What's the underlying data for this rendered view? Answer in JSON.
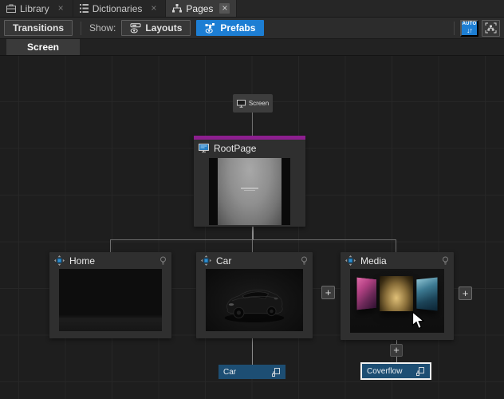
{
  "tab_bar": {
    "close_glyph": "×",
    "tabs": [
      {
        "label": "Library"
      },
      {
        "label": "Dictionaries"
      },
      {
        "label": "Pages"
      }
    ]
  },
  "toolbar": {
    "transitions_label": "Transitions",
    "show_label": "Show:",
    "layouts_label": "Layouts",
    "prefabs_label": "Prefabs",
    "auto_label": "AUTO",
    "auto_arrows": "↓↑"
  },
  "breadcrumb": {
    "screen_tab": "Screen"
  },
  "graph": {
    "screen_node": {
      "label": "Screen"
    },
    "root_node": {
      "label": "RootPage"
    },
    "children": [
      {
        "label": "Home"
      },
      {
        "label": "Car"
      },
      {
        "label": "Media"
      }
    ],
    "plus_label": "+",
    "references": [
      {
        "label": "Car"
      },
      {
        "label": "Coverflow"
      }
    ]
  },
  "colors": {
    "accent_blue": "#1d7ed3",
    "node_purple": "#8d1f8f",
    "reference_blue": "#1d4e73"
  }
}
